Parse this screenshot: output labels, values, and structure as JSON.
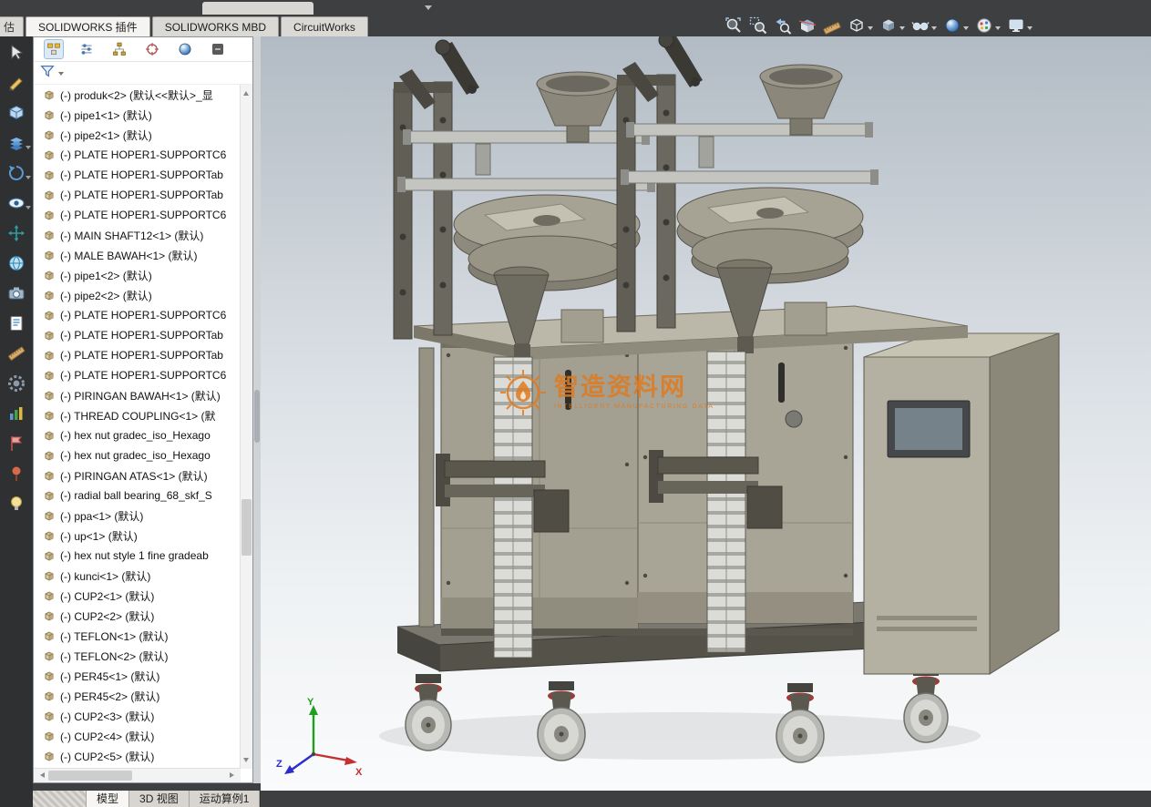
{
  "window": {
    "bg": "#3e3f41"
  },
  "command_tabs": {
    "partial": "估",
    "items": [
      {
        "label": "SOLIDWORKS 插件",
        "active": true
      },
      {
        "label": "SOLIDWORKS MBD",
        "active": false
      },
      {
        "label": "CircuitWorks",
        "active": false
      }
    ]
  },
  "headsup": {
    "buttons": [
      {
        "name": "zoom-fit-button",
        "icon": "zoom-fit",
        "caret": false
      },
      {
        "name": "zoom-area-button",
        "icon": "zoom-area",
        "caret": false
      },
      {
        "name": "previous-view-button",
        "icon": "previous-view",
        "caret": false
      },
      {
        "name": "section-view-button",
        "icon": "section-view",
        "caret": false
      },
      {
        "name": "measure-button",
        "icon": "measure",
        "caret": false
      },
      {
        "name": "display-style-button",
        "icon": "display-style",
        "caret": true
      },
      {
        "name": "view-orientation-button",
        "icon": "view-orientation",
        "caret": true
      },
      {
        "name": "hide-show-items-button",
        "icon": "hide-show",
        "caret": true
      },
      {
        "name": "edit-appearance-button",
        "icon": "appearance",
        "caret": true
      },
      {
        "name": "apply-scene-button",
        "icon": "scene",
        "caret": true
      },
      {
        "name": "view-settings-button",
        "icon": "view-settings",
        "caret": true
      }
    ]
  },
  "left_toolbar": {
    "icons": [
      {
        "name": "select-arrow-icon",
        "glyph": "arrow",
        "caret": false
      },
      {
        "name": "sketch-pencil-icon",
        "glyph": "pencil",
        "caret": false
      },
      {
        "name": "cube-icon",
        "glyph": "cube",
        "caret": false
      },
      {
        "name": "layers-icon",
        "glyph": "layers",
        "caret": true
      },
      {
        "name": "rotate-view-icon",
        "glyph": "rotate",
        "caret": true
      },
      {
        "name": "eye-icon",
        "glyph": "eye",
        "caret": true
      },
      {
        "name": "move-icon",
        "glyph": "move",
        "caret": false
      },
      {
        "name": "globe-icon",
        "glyph": "world",
        "caret": false
      },
      {
        "name": "camera-icon",
        "glyph": "camera",
        "caret": false
      },
      {
        "name": "note-icon",
        "glyph": "note",
        "caret": false
      },
      {
        "name": "ruler-icon",
        "glyph": "ruler",
        "caret": false
      },
      {
        "name": "gear-icon",
        "glyph": "gear",
        "caret": false
      },
      {
        "name": "chart-icon",
        "glyph": "chart",
        "caret": false
      },
      {
        "name": "flag-icon",
        "glyph": "flag",
        "caret": false
      },
      {
        "name": "pin-icon",
        "glyph": "pin",
        "caret": false
      },
      {
        "name": "bulb-icon",
        "glyph": "bulb",
        "caret": false
      }
    ]
  },
  "feature_panel": {
    "tabs": [
      {
        "name": "feature-manager-tab",
        "glyph": "tree",
        "active": true
      },
      {
        "name": "property-manager-tab",
        "glyph": "sliders",
        "active": false
      },
      {
        "name": "configuration-manager-tab",
        "glyph": "config",
        "active": false
      },
      {
        "name": "dimxpert-manager-tab",
        "glyph": "target",
        "active": false
      },
      {
        "name": "display-manager-tab",
        "glyph": "ball",
        "active": false
      },
      {
        "name": "pane-options-tab",
        "glyph": "pane",
        "active": false
      }
    ]
  },
  "feature_tree": {
    "items": [
      {
        "label": "(-) produk<2> (默认<<默认>_显"
      },
      {
        "label": "(-) pipe1<1> (默认)"
      },
      {
        "label": "(-) pipe2<1> (默认)"
      },
      {
        "label": "(-) PLATE HOPER1-SUPPORTC6"
      },
      {
        "label": "(-) PLATE HOPER1-SUPPORTab"
      },
      {
        "label": "(-) PLATE HOPER1-SUPPORTab"
      },
      {
        "label": "(-) PLATE HOPER1-SUPPORTC6"
      },
      {
        "label": "(-) MAIN SHAFT12<1> (默认)"
      },
      {
        "label": "(-) MALE BAWAH<1> (默认)"
      },
      {
        "label": "(-) pipe1<2> (默认)"
      },
      {
        "label": "(-) pipe2<2> (默认)"
      },
      {
        "label": "(-) PLATE HOPER1-SUPPORTC6"
      },
      {
        "label": "(-) PLATE HOPER1-SUPPORTab"
      },
      {
        "label": "(-) PLATE HOPER1-SUPPORTab"
      },
      {
        "label": "(-) PLATE HOPER1-SUPPORTC6"
      },
      {
        "label": "(-) PIRINGAN BAWAH<1> (默认)"
      },
      {
        "label": "(-) THREAD COUPLING<1> (默"
      },
      {
        "label": "(-) hex nut gradec_iso_Hexago"
      },
      {
        "label": "(-) hex nut gradec_iso_Hexago"
      },
      {
        "label": "(-) PIRINGAN ATAS<1> (默认)"
      },
      {
        "label": "(-) radial ball bearing_68_skf_S"
      },
      {
        "label": "(-) ppa<1> (默认)"
      },
      {
        "label": "(-) up<1> (默认)"
      },
      {
        "label": "(-) hex nut style 1 fine gradeab"
      },
      {
        "label": "(-) kunci<1> (默认)"
      },
      {
        "label": "(-) CUP2<1> (默认)"
      },
      {
        "label": "(-) CUP2<2> (默认)"
      },
      {
        "label": "(-) TEFLON<1> (默认)"
      },
      {
        "label": "(-) TEFLON<2> (默认)"
      },
      {
        "label": "(-) PER45<1> (默认)"
      },
      {
        "label": "(-) PER45<2> (默认)"
      },
      {
        "label": "(-) CUP2<3> (默认)"
      },
      {
        "label": "(-) CUP2<4> (默认)"
      },
      {
        "label": "(-) CUP2<5> (默认)"
      }
    ]
  },
  "statusbar": {
    "tabs": [
      {
        "label": "模型",
        "active": true
      },
      {
        "label": "3D 视图",
        "active": false
      },
      {
        "label": "运动算例1",
        "active": false
      }
    ]
  },
  "watermark": {
    "title": "智造资料网",
    "subtitle": "INTELLIGENT MANUFACTURING DATA",
    "color": "#e07b1f"
  },
  "triad": {
    "x": "X",
    "y": "Y",
    "z": "Z"
  }
}
